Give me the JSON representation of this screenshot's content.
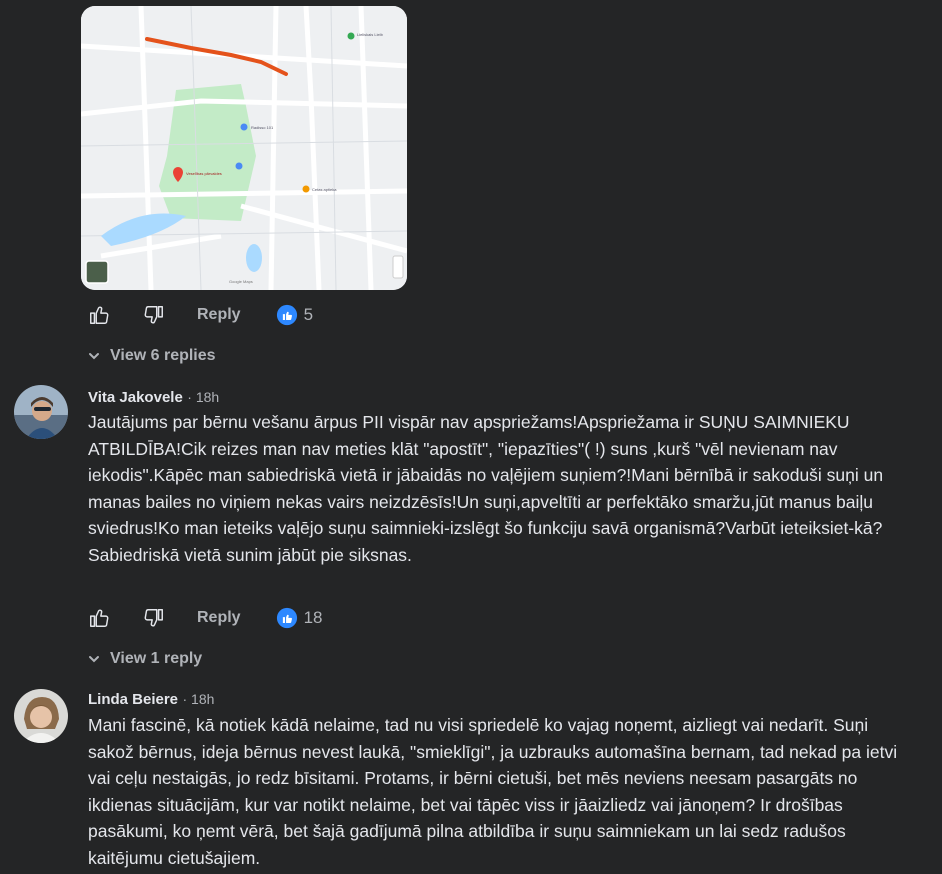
{
  "map": {
    "labels": {
      "place_name": "Veselības pārvaldes\nrajona vides...",
      "poi_1": "Radisso 101",
      "poi_2": "Lieliskais Lielb\nDārziņš",
      "poi_3": "Cetas aptieka",
      "google": "Google Maps"
    },
    "route_color": "#e4521b",
    "park_color": "#c3ebc7"
  },
  "comments": [
    {
      "reactions": {
        "reply_label": "Reply",
        "like_count": "5"
      },
      "view_replies": "View 6 replies"
    },
    {
      "author": "Vita Jakovele",
      "time": "18h",
      "text": "Jautājums par bērnu vešanu ārpus PII vispār nav apspriežams!Apspriežama ir SUŅU SAIMNIEKU ATBILDĪBA!Cik reizes man nav meties klāt \"apostīt\", \"iepazīties\"( !) suns ,kurš \"vēl nevienam nav iekodis\".Kāpēc man sabiedriskā vietā ir jābaidās no vaļējiem suņiem?!Mani bērnībā ir sakoduši suņi un manas bailes no viņiem nekas vairs neizdzēsīs!Un suņi,apveltīti ar perfektāko smaržu,jūt manus baiļu sviedrus!Ko man ieteiks vaļējo suņu saimnieki-izslēgt šo funkciju savā organismā?Varbūt ieteiksiet-kā?Sabiedriskā vietā sunim jābūt pie siksnas.",
      "reply_label": "Reply",
      "like_count": "18",
      "view_replies": "View 1 reply"
    },
    {
      "author": "Linda Beiere",
      "time": "18h",
      "text": "Mani fascinē, kā notiek kādā nelaime, tad nu visi spriedelē ko vajag noņemt, aizliegt vai nedarīt. Suņi sakož bērnus, ideja bērnus nevest laukā, \"smieklīgi\", ja uzbrauks automašīna bernam, tad nekad pa ietvi vai ceļu nestaigās, jo redz bīsitami. Protams, ir bērni cietuši, bet mēs neviens neesam pasargāts no ikdienas situācijām, kur var notikt nelaime, bet vai tāpēc viss ir jāaizliedz vai jānoņem? Ir drošības pasākumi, ko ņemt vērā, bet šajā gadījumā pilna atbildība ir suņu saimniekam un lai sedz radušos kaitējumu cietušajiem."
    }
  ],
  "colors": {
    "background": "#242526",
    "text": "#e4e6eb",
    "muted": "#b0b3b8",
    "like_blue": "#2d88ff"
  }
}
